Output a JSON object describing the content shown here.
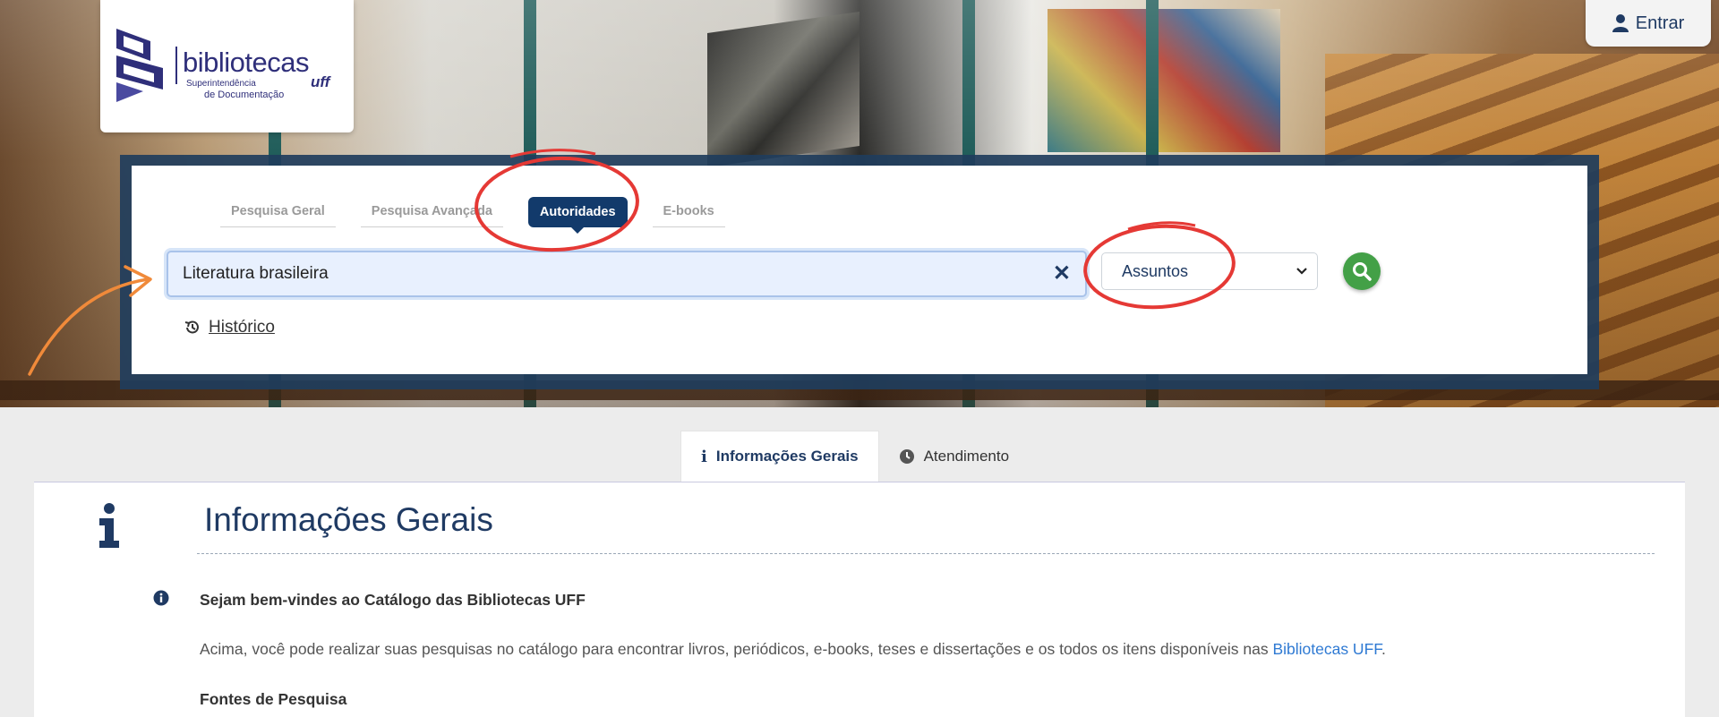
{
  "header": {
    "logo": {
      "name": "bibliotecas",
      "sub_line1": "Superintendência",
      "sub_line2": "de Documentação",
      "uff": "uff"
    },
    "login_label": "Entrar"
  },
  "search": {
    "tabs": [
      {
        "label": "Pesquisa Geral",
        "active": false
      },
      {
        "label": "Pesquisa Avançada",
        "active": false
      },
      {
        "label": "Autoridades",
        "active": true
      },
      {
        "label": "E-books",
        "active": false
      }
    ],
    "query_value": "Literatura brasileira",
    "scope_selected": "Assuntos",
    "history_label": "Histórico"
  },
  "info": {
    "tabs": [
      {
        "label": "Informações Gerais",
        "active": true
      },
      {
        "label": "Atendimento",
        "active": false
      }
    ],
    "title": "Informações Gerais",
    "welcome": "Sejam bem-vindes ao Catálogo das Bibliotecas UFF",
    "paragraph_text": "Acima, você pode realizar suas pesquisas no catálogo para encontrar livros, periódicos, e-books, teses e dissertações e os todos os itens disponíveis nas ",
    "paragraph_link": "Bibliotecas UFF",
    "paragraph_end": ".",
    "sources_heading": "Fontes de Pesquisa"
  },
  "colors": {
    "brand": "#1f3a63",
    "active_tab": "#123a6b",
    "search_button": "#43a047",
    "annotation_red": "#e53935",
    "annotation_orange": "#f08a3a",
    "link": "#2f7ad3"
  }
}
